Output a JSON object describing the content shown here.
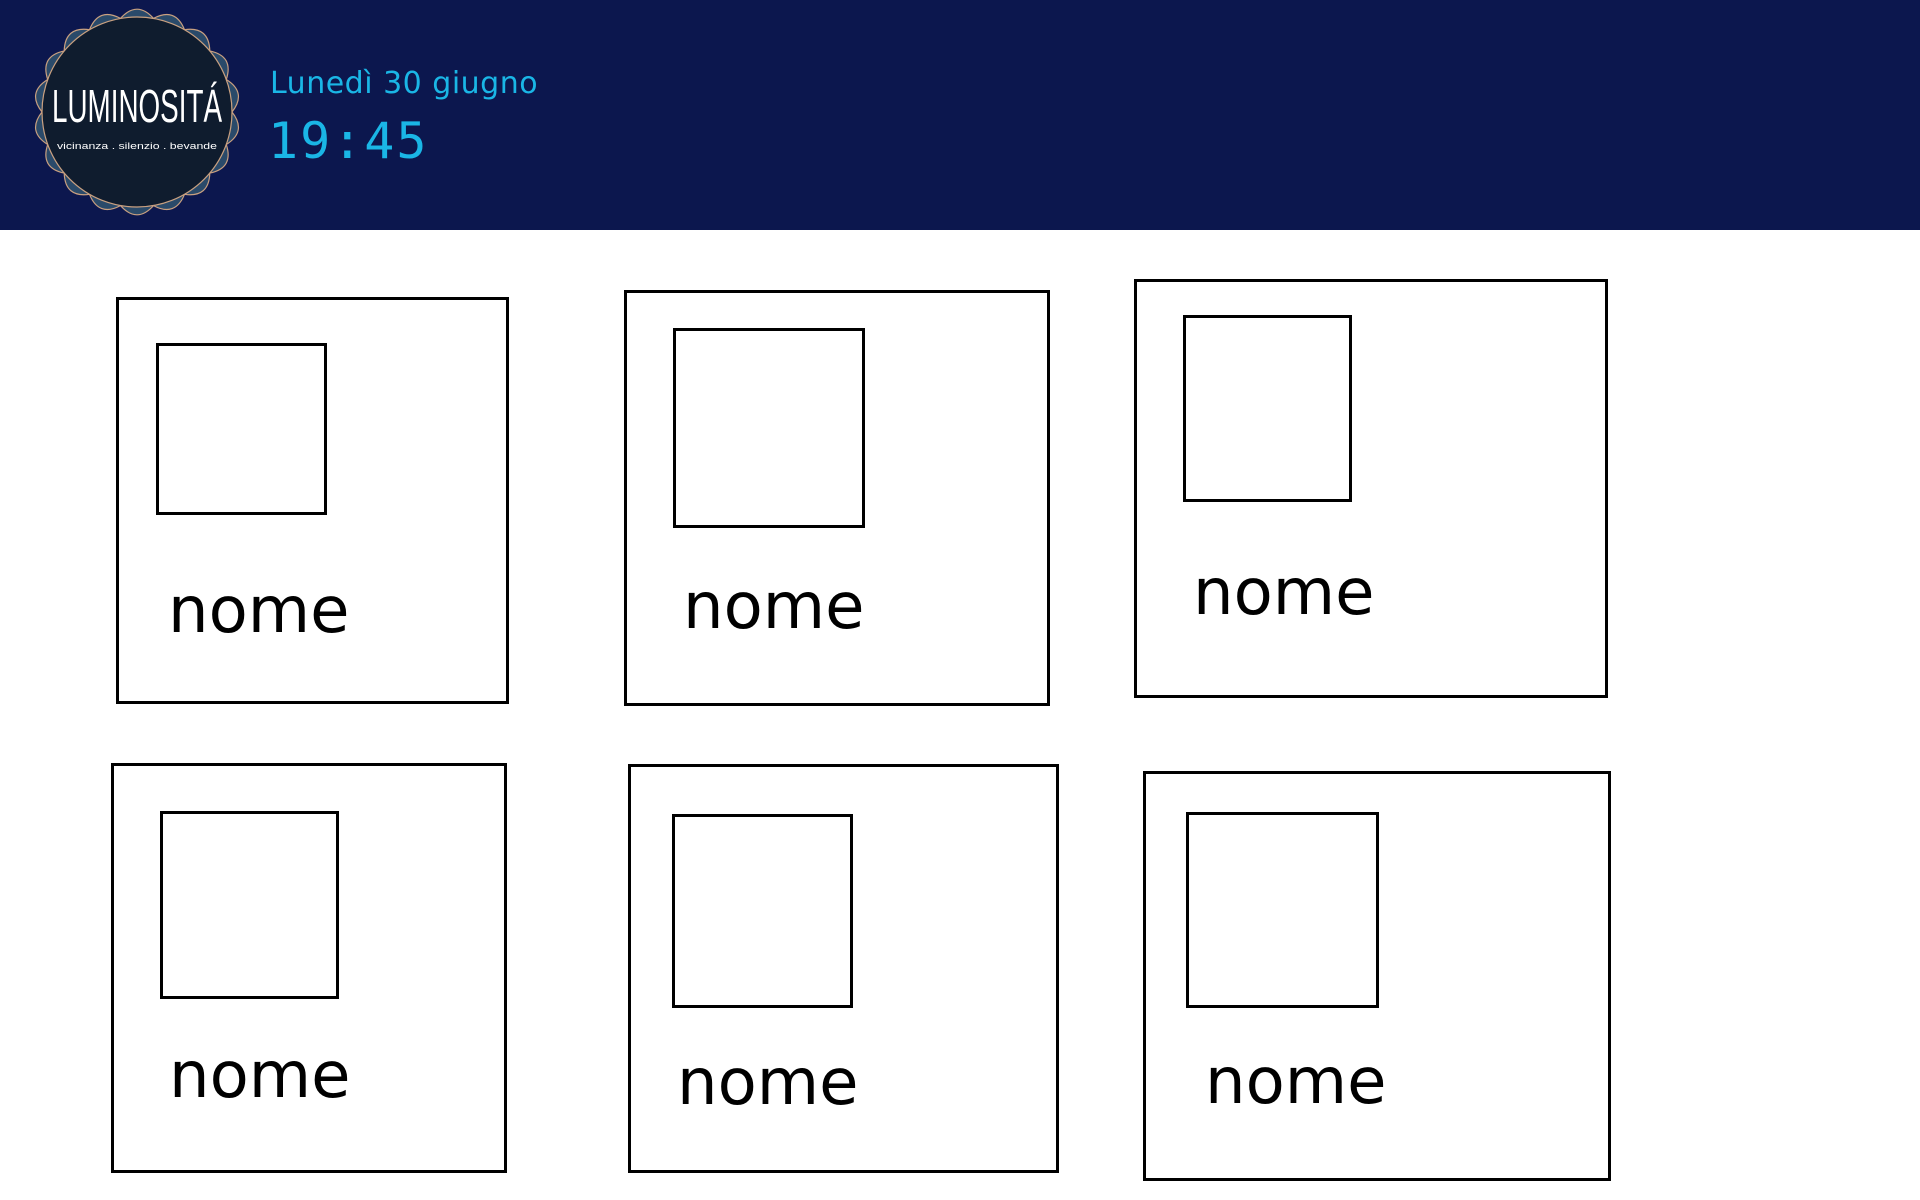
{
  "header": {
    "brand": {
      "name": "LUMINOSITÁ",
      "tagline": "vicinanza . silenzio . bevande"
    },
    "date": "Lunedì 30 giugno",
    "time": "19:45"
  },
  "cards": [
    {
      "name": "nome"
    },
    {
      "name": "nome"
    },
    {
      "name": "nome"
    },
    {
      "name": "nome"
    },
    {
      "name": "nome"
    },
    {
      "name": "nome"
    }
  ],
  "colors": {
    "header_bg": "#0c174e",
    "accent": "#1ab6e6",
    "logo_bg": "#0f1c2e",
    "logo_rays": "#2a4a6a"
  }
}
